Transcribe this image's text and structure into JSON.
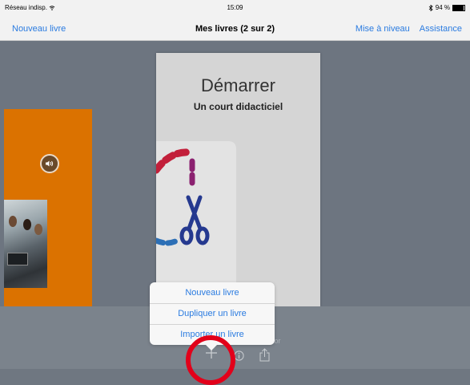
{
  "status_bar": {
    "carrier": "Réseau indisp.",
    "time": "15:09",
    "battery": "94 %",
    "battery_level": 0.94
  },
  "nav_bar": {
    "left_button": "Nouveau livre",
    "title": "Mes livres (2 sur 2)",
    "right_buttons": [
      "Mise à niveau",
      "Assistance"
    ]
  },
  "featured_book": {
    "title": "Démarrer",
    "subtitle": "Un court didacticiel"
  },
  "popover_menu": {
    "items": [
      "Nouveau livre",
      "Dupliquer un livre",
      "Importer un livre"
    ]
  },
  "bottom_bar": {
    "partial_label": "tor"
  },
  "icons": {
    "add": "plus-icon",
    "info": "info-icon",
    "share": "share-icon",
    "audio": "speaker-icon"
  },
  "colors": {
    "accent": "#2a7be0",
    "highlight": "#e2001a",
    "book_orange": "#db7200"
  }
}
